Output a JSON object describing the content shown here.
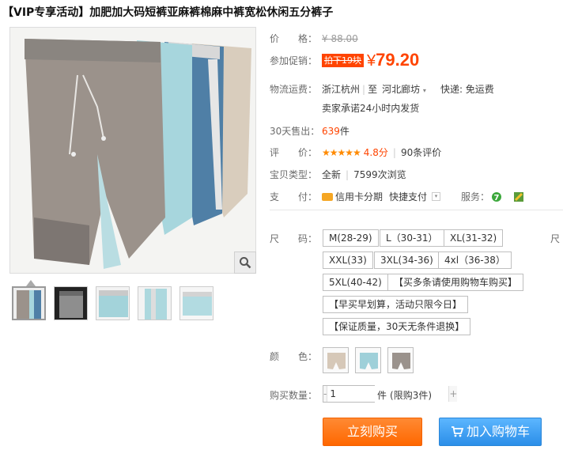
{
  "title": "【VIP专享活动】加肥加大码短裤亚麻裤棉麻中裤宽松休闲五分裤子",
  "price": {
    "label": "价　　格：",
    "original": "¥ 88.00"
  },
  "promo": {
    "label": "参加促销：",
    "tag": "拍下19块",
    "currency": "¥",
    "value": "79.20"
  },
  "shipping": {
    "label": "物流运费：",
    "from": "浙江杭州",
    "to_prefix": "至",
    "to": "河北廊坊",
    "dropdown_icon": "caret-down-icon",
    "express": "快递: 免运费",
    "promise": "卖家承诺24小时内发货"
  },
  "sales": {
    "label": "30天售出：",
    "count": "639",
    "unit": "件"
  },
  "rating": {
    "label": "评　　价：",
    "stars": "★★★★★",
    "score": "4.8分",
    "reviews": "90条评价"
  },
  "item_type": {
    "label": "宝贝类型：",
    "condition": "全新",
    "views": "7599次浏览"
  },
  "payment": {
    "label": "支　　付：",
    "credit": "信用卡分期",
    "quick": "快捷支付",
    "service_label": "服务："
  },
  "size": {
    "label": "尺　　码：",
    "options": [
      "M(28-29)",
      "L（30-31）",
      "XL(31-32)",
      "XXL(33)",
      "3XL(34-36)",
      "4xl（36-38）",
      "5XL(40-42)",
      "【买多条请使用购物车购买】",
      "【早买早划算，活动只限今日】",
      "【保证质量，30天无条件退换】"
    ],
    "overflow": "尺"
  },
  "color": {
    "label": "颜　　色："
  },
  "quantity": {
    "label": "购买数量：",
    "value": "1",
    "minus": "-",
    "plus": "+",
    "unit": "件",
    "limit": "(限购3件)"
  },
  "buttons": {
    "buy_now": "立刻购买",
    "add_to_cart": "加入购物车"
  },
  "colors": {
    "accent": "#ff4400",
    "buy": "#ff7a1a",
    "cart": "#3a9cf0",
    "stars": "#ff8a00"
  }
}
